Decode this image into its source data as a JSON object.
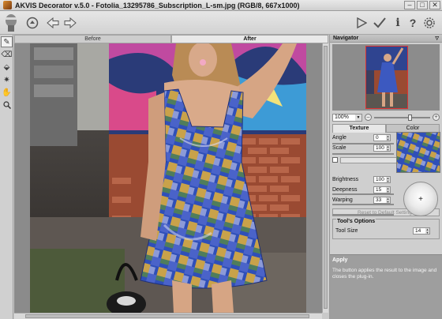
{
  "window": {
    "title": "AKVIS Decorator v.5.0 - Fotolia_13295786_Subscription_L-sm.jpg (RGB/8, 667x1000)",
    "controls": [
      "–",
      "□",
      "✕"
    ]
  },
  "toolbar": {
    "icons": [
      "akvis-logo-icon",
      "toolbox-icon",
      "back-arrow-icon",
      "forward-arrow-icon",
      "run-icon",
      "apply-icon",
      "info-icon",
      "help-icon",
      "settings-icon"
    ]
  },
  "left_tools": [
    "selection-brush-icon",
    "eraser-icon",
    "bucket-icon",
    "magic-icon",
    "hand-icon",
    "zoom-icon"
  ],
  "view_tabs": {
    "before": "Before",
    "after": "After"
  },
  "navigator": {
    "title": "Navigator",
    "zoom_value": "100%",
    "zoom_fraction": 0.6
  },
  "texture_tabs": {
    "texture": "Texture",
    "color": "Color"
  },
  "params": {
    "angle": {
      "label": "Angle",
      "value": "0"
    },
    "scale": {
      "label": "Scale",
      "value": "100"
    },
    "brightness": {
      "label": "Brightness",
      "value": "100"
    },
    "deepness": {
      "label": "Deepness",
      "value": "15"
    },
    "warping": {
      "label": "Warping",
      "value": "33"
    }
  },
  "reset_label": "Reset to Default Settings",
  "tools_options": {
    "title": "Tool's Options",
    "tool_size_label": "Tool Size",
    "tool_size_value": "14"
  },
  "hint": {
    "title": "Apply",
    "text": "The button applies the result to the image and closes the plug-in."
  },
  "colors": {
    "accent_red": "#d33a2a",
    "texture_blue": "#2f4fb8",
    "texture_gold": "#c9a24a",
    "texture_green": "#4f7d5c"
  }
}
